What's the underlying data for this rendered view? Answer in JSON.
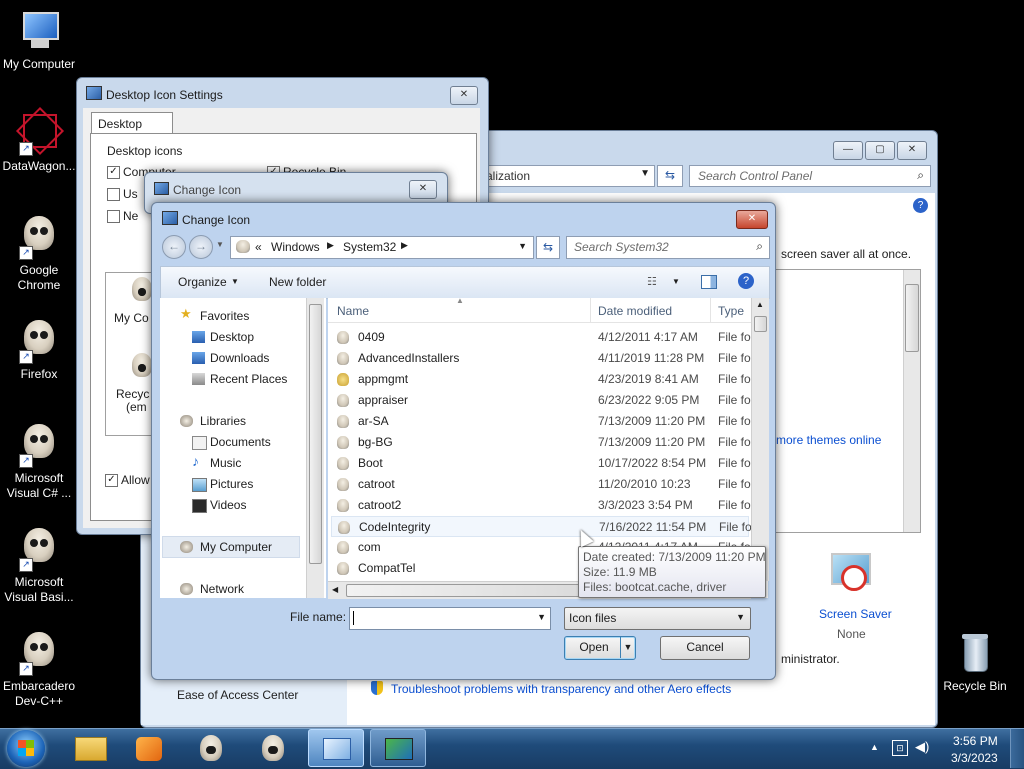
{
  "desktop": {
    "icons": [
      {
        "label": "My Computer"
      },
      {
        "label": "DataWagon..."
      },
      {
        "label": "Google Chrome"
      },
      {
        "label": "Firefox"
      },
      {
        "label": "Microsoft Visual C# ..."
      },
      {
        "label": "Microsoft Visual Basi..."
      },
      {
        "label": "Embarcadero Dev-C++"
      },
      {
        "label": "Recycle Bin"
      }
    ]
  },
  "control_panel": {
    "address_text": "alization",
    "search_placeholder": "Search Control Panel",
    "body_text": "screen saver all at once.",
    "themes_link": "more themes online",
    "screen_saver_label": "Screen Saver",
    "screen_saver_value": "None",
    "admin_text": "ministrator.",
    "ease_access": "Ease of Access Center",
    "troubleshoot_link": "Troubleshoot problems with transparency and other Aero effects"
  },
  "desktop_icon_settings": {
    "title": "Desktop Icon Settings",
    "tab": "Desktop Icons",
    "group_label": "Desktop icons",
    "checkbox_computer": "Computer",
    "checkbox_recycle": "Recycle Bin",
    "checkbox_us": "Us",
    "checkbox_ne": "Ne",
    "preview_my": "My Co",
    "preview_recycle_1": "Recyc",
    "preview_recycle_2": "(em",
    "allow": "Allow"
  },
  "change_icon_back": {
    "title": "Change Icon"
  },
  "change_icon_dialog": {
    "title": "Change Icon",
    "breadcrumb": {
      "prefix": "«",
      "part1": "Windows",
      "part2": "System32"
    },
    "search_placeholder": "Search System32",
    "toolbar": {
      "organize": "Organize",
      "new_folder": "New folder"
    },
    "nav": {
      "favorites": "Favorites",
      "desktop": "Desktop",
      "downloads": "Downloads",
      "recent": "Recent Places",
      "libraries": "Libraries",
      "documents": "Documents",
      "music": "Music",
      "pictures": "Pictures",
      "videos": "Videos",
      "my_computer": "My Computer",
      "network": "Network"
    },
    "columns": {
      "name": "Name",
      "date": "Date modified",
      "type": "Type"
    },
    "files": [
      {
        "name": "0409",
        "date": "4/12/2011 4:17 AM",
        "type": "File fol"
      },
      {
        "name": "AdvancedInstallers",
        "date": "4/11/2019 11:28 PM",
        "type": "File fol"
      },
      {
        "name": "appmgmt",
        "date": "4/23/2019 8:41 AM",
        "type": "File fol"
      },
      {
        "name": "appraiser",
        "date": "6/23/2022 9:05 PM",
        "type": "File fol"
      },
      {
        "name": "ar-SA",
        "date": "7/13/2009 11:20 PM",
        "type": "File fol"
      },
      {
        "name": "bg-BG",
        "date": "7/13/2009 11:20 PM",
        "type": "File fol"
      },
      {
        "name": "Boot",
        "date": "10/17/2022 8:54 PM",
        "type": "File fol"
      },
      {
        "name": "catroot",
        "date": "11/20/2010 10:23",
        "type": "File fol"
      },
      {
        "name": "catroot2",
        "date": "3/3/2023 3:54 PM",
        "type": "File fol"
      },
      {
        "name": "CodeIntegrity",
        "date": "7/16/2022 11:54 PM",
        "type": "File fol"
      },
      {
        "name": "com",
        "date": "4/12/2011 4:17 AM",
        "type": "File fol"
      },
      {
        "name": "CompatTel",
        "date": "",
        "type": ""
      }
    ],
    "tooltip": {
      "line1": "Date created: 7/13/2009 11:20 PM",
      "line2": "Size: 11.9 MB",
      "line3": "Files: bootcat.cache, driver"
    },
    "file_name_label": "File name:",
    "file_name_value": "",
    "filter": "Icon files",
    "open": "Open",
    "cancel": "Cancel"
  },
  "taskbar": {
    "time": "3:56 PM",
    "date": "3/3/2023"
  },
  "colors": {
    "taskbar": "#1f4b7a",
    "link": "#0b4fd1",
    "selection": "#cce8ff"
  }
}
